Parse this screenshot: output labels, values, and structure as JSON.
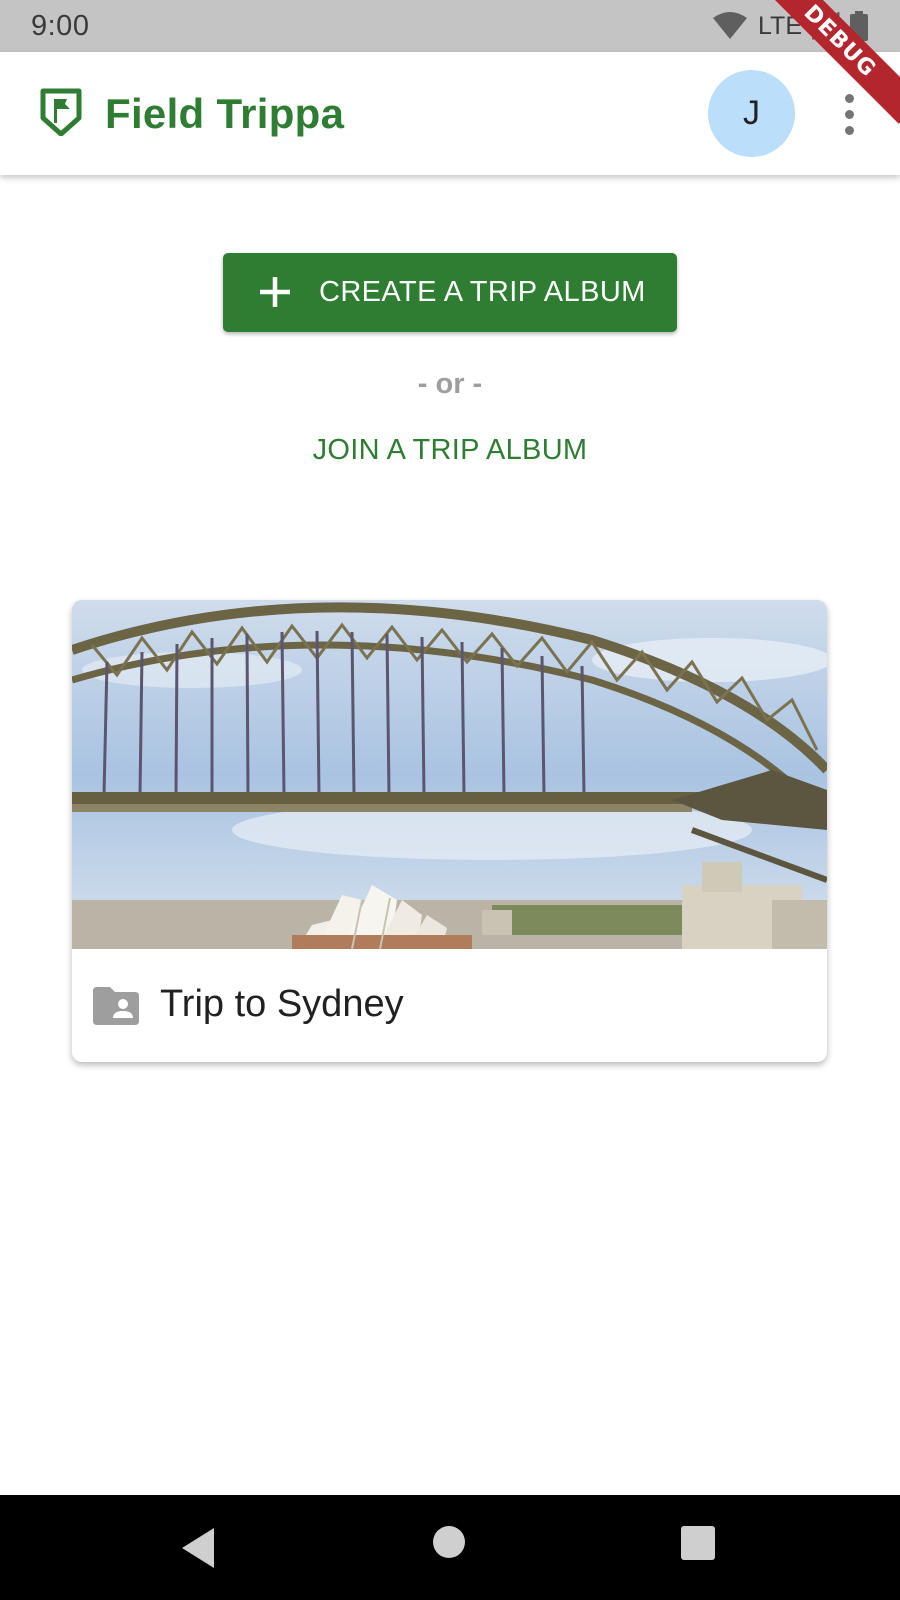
{
  "status_bar": {
    "time": "9:00",
    "network": "LTE",
    "icons": [
      "wifi-icon",
      "cell-signal-icon",
      "battery-icon"
    ]
  },
  "debug_banner": {
    "label": "DEBUG",
    "color": "#b3262d"
  },
  "app_bar": {
    "logo_icon": "flag-shield-icon",
    "title": "Field Trippa",
    "avatar_initial": "J",
    "menu_icon": "more-vert-icon"
  },
  "actions": {
    "create_label": "CREATE A TRIP ALBUM",
    "create_icon": "plus-icon",
    "or_divider": "- or -",
    "join_label": "JOIN A TRIP ALBUM"
  },
  "albums": [
    {
      "title": "Trip to Sydney",
      "icon": "folder-shared-icon",
      "image": "sydney-harbour-bridge-photo"
    }
  ],
  "nav_bar": {
    "buttons": [
      "back-icon",
      "home-icon",
      "recents-icon"
    ]
  },
  "colors": {
    "primary": "#2e7d32",
    "avatar_bg": "#bbdefb",
    "status_bar_bg": "#c4c4c4",
    "muted_text": "#9e9e9e"
  }
}
